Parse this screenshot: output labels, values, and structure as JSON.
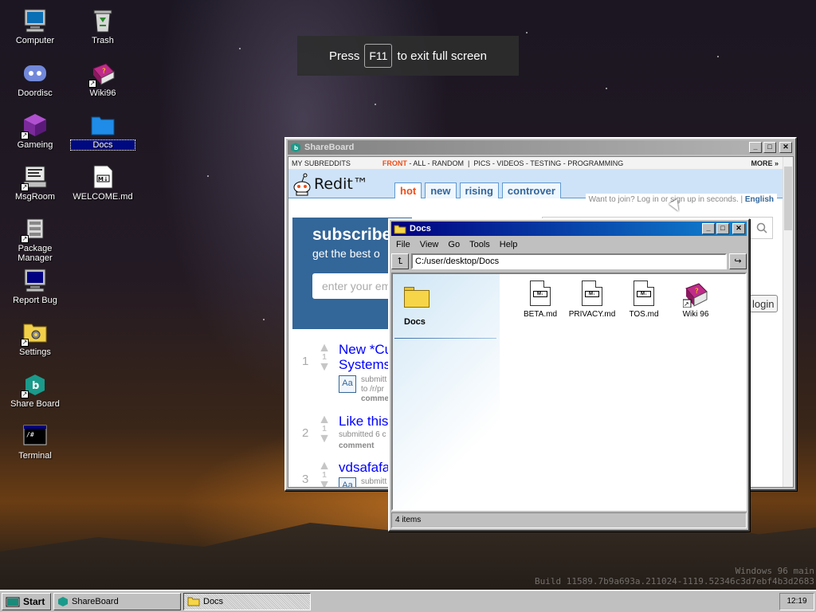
{
  "desktop": {
    "icons": [
      {
        "label": "Computer"
      },
      {
        "label": "Trash"
      },
      {
        "label": "Doordisc"
      },
      {
        "label": "Wiki96"
      },
      {
        "label": "Gameing"
      },
      {
        "label": "Docs"
      },
      {
        "label": "MsgRoom"
      },
      {
        "label": "WELCOME.md"
      },
      {
        "label": "Package Manager"
      },
      {
        "label": "Report Bug"
      },
      {
        "label": "Settings"
      },
      {
        "label": "Share Board"
      },
      {
        "label": "Terminal"
      }
    ],
    "build_line1": "Windows 96 main",
    "build_line2": "Build 11589.7b9a693a.211024-1119.52346c3d7ebf4b3d2683"
  },
  "toast": {
    "prefix": "Press",
    "key": "F11",
    "suffix": "to exit full screen"
  },
  "shareboard": {
    "title": "ShareBoard",
    "nav_my": "MY SUBREDDITS",
    "nav_front": "FRONT",
    "nav_rest": " - ALL - RANDOM  |  PICS - VIDEOS - TESTING - PROGRAMMING",
    "nav_more": "MORE »",
    "logo": "Redit™",
    "tabs": [
      "hot",
      "new",
      "rising",
      "controver"
    ],
    "join_text": "Want to join? Log in or sign up in seconds.",
    "join_lang": "English",
    "subscribe_head": "subscribe",
    "subscribe_sub": "get the best o",
    "email_placeholder": "enter your em",
    "login": "login",
    "posts": [
      {
        "rank": "1",
        "score": "1",
        "title": "New *Cu",
        "title2": "Systems",
        "meta1": "submitt",
        "meta2": "to /r/pr",
        "action": "comme"
      },
      {
        "rank": "2",
        "score": "1",
        "title": "Like this",
        "meta1": "submitted 6 c",
        "action": "comment"
      },
      {
        "rank": "3",
        "score": "1",
        "title": "vdsafafa",
        "meta1": "submitt",
        "action": "comme"
      }
    ]
  },
  "docs": {
    "title": "Docs",
    "menu": [
      "File",
      "View",
      "Go",
      "Tools",
      "Help"
    ],
    "path": "C:/user/desktop/Docs",
    "folder_title": "Docs",
    "files": [
      {
        "name": "BETA.md"
      },
      {
        "name": "PRIVACY.md"
      },
      {
        "name": "TOS.md"
      },
      {
        "name": "Wiki 96"
      }
    ],
    "status": "4 items"
  },
  "taskbar": {
    "start": "Start",
    "tasks": [
      {
        "label": "ShareBoard"
      },
      {
        "label": "Docs"
      }
    ],
    "clock": "12:19"
  }
}
